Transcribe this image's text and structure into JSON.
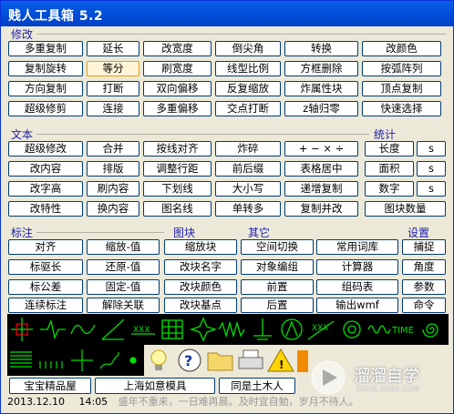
{
  "window": {
    "title": "贱人工具箱  5.2"
  },
  "sections": {
    "modify": "修改",
    "text": "文本",
    "stats": "统计",
    "annotate": "标注",
    "block": "图块",
    "other": "其它",
    "settings": "设置"
  },
  "modify_buttons": [
    "多重复制",
    "延长",
    "改宽度",
    "倒尖角",
    "转换",
    "改颜色",
    "复制旋转",
    "等分",
    "刷宽度",
    "线型比例",
    "方框删除",
    "按弧阵列",
    "方向复制",
    "打断",
    "双向偏移",
    "反复缩放",
    "炸属性块",
    "顶点复制",
    "超级修剪",
    "连接",
    "多重偏移",
    "交点打断",
    "z轴归零",
    "快速选择"
  ],
  "text_buttons": [
    "超级修改",
    "合并",
    "按线对齐",
    "炸碎",
    "+ − × ÷",
    "改内容",
    "排版",
    "调整行距",
    "前后缀",
    "表格居中",
    "改字高",
    "刷内容",
    "下划线",
    "大小写",
    "递增复制",
    "改特性",
    "换内容",
    "图名线",
    "单转多",
    "复制并改"
  ],
  "stats_buttons": [
    {
      "label": "长度",
      "extra": "s"
    },
    {
      "label": "面积",
      "extra": "s"
    },
    {
      "label": "数字",
      "extra": "s"
    },
    {
      "label": "图块数量",
      "extra": ""
    }
  ],
  "annotate_buttons": [
    "对齐",
    "缩放-值",
    "标驱长",
    "还原-值",
    "标公差",
    "固定-值",
    "连续标注",
    "解除关联"
  ],
  "block_buttons": [
    "缩放块",
    "改块名字",
    "改块颜色",
    "改块基点"
  ],
  "other_buttons": [
    "空间切换",
    "常用词库",
    "对象编组",
    "计算器",
    "前置",
    "组码表",
    "后置",
    "输出wmf"
  ],
  "settings_buttons": [
    "捕捉",
    "角度",
    "参数",
    "命令"
  ],
  "icon_row": [
    "crosshair-icon",
    "zigzag-icon",
    "wave-icon",
    "angle-icon",
    "xxx-line-icon",
    "grid-block-icon",
    "star-icon",
    "spring-icon",
    "ground-icon",
    "circle-a-icon",
    "xxx-slant-icon",
    "gear-icon",
    "wavy-line-icon",
    "time-text-icon",
    "spiral-icon",
    "hook-arrow-icon"
  ],
  "tool_row": [
    "coil-icon",
    "dashes-icon",
    "dots-grid-icon",
    "s-curve-icon",
    "dot-icon",
    "bulb-icon",
    "help-icon",
    "folder-icon",
    "printer-icon",
    "warning-icon",
    "construction-icon"
  ],
  "bottom_buttons": [
    "宝宝精品屋",
    "上海如意模具",
    "同是土木人"
  ],
  "status": {
    "date": "2013.12.10",
    "time": "14:05",
    "message": "盛年不重来，一日难再晨。及时宜自勉，岁月不待人。"
  },
  "watermark": {
    "brand": "溜溜自学",
    "url": "ZIXUE.3D66.COM"
  },
  "colors": {
    "title_bar": "#0054e3",
    "section_label": "#2020b0",
    "selected": "#fff4d6"
  }
}
